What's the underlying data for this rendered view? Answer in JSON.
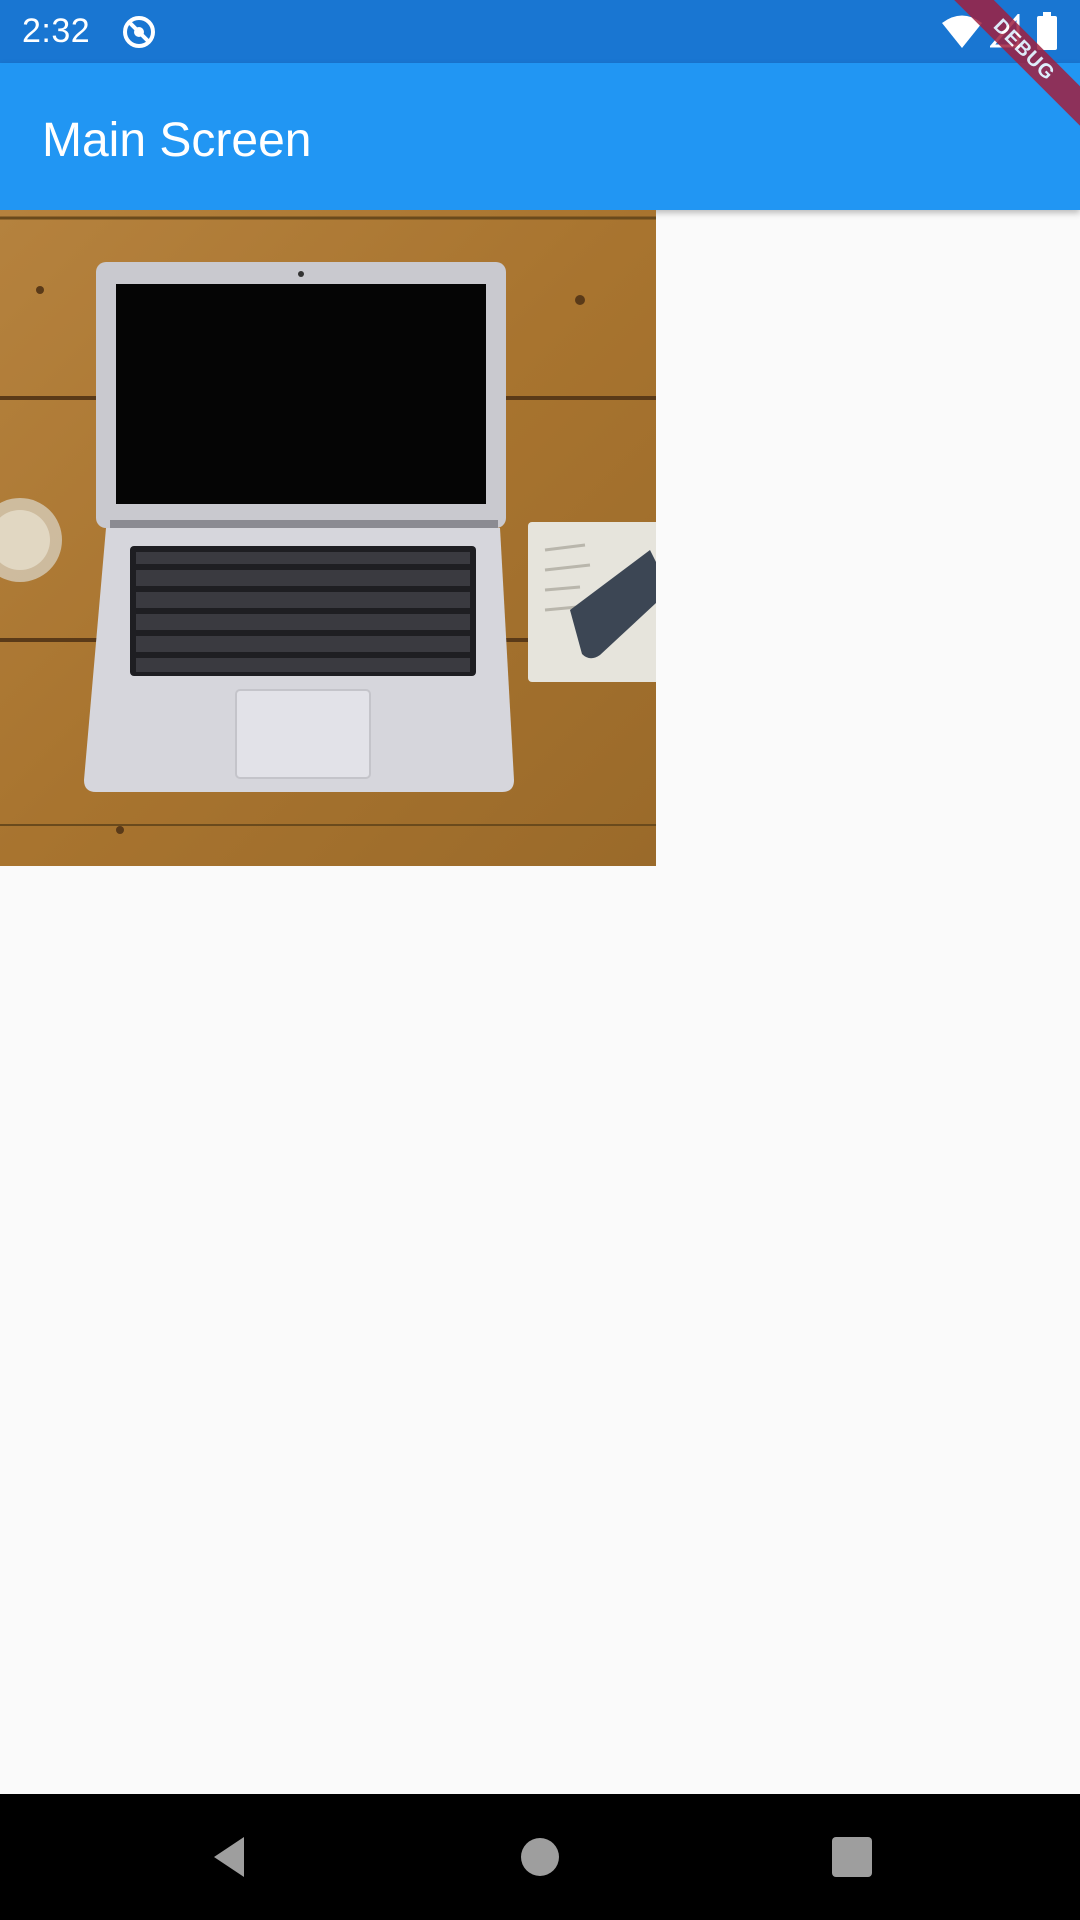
{
  "status_bar": {
    "time": "2:32",
    "background": "#1976d2",
    "icons": [
      "sync-disabled-icon",
      "wifi-icon",
      "signal-icon",
      "battery-icon"
    ]
  },
  "app_bar": {
    "title": "Main Screen",
    "background": "#2196f3"
  },
  "debug_banner": {
    "label": "DEBUG",
    "color": "#a02040"
  },
  "content": {
    "image": {
      "subject": "laptop-on-wooden-desk-photo"
    }
  },
  "navigation_bar": {
    "buttons": [
      "back-icon",
      "home-icon",
      "recents-icon"
    ],
    "background": "#000000"
  }
}
